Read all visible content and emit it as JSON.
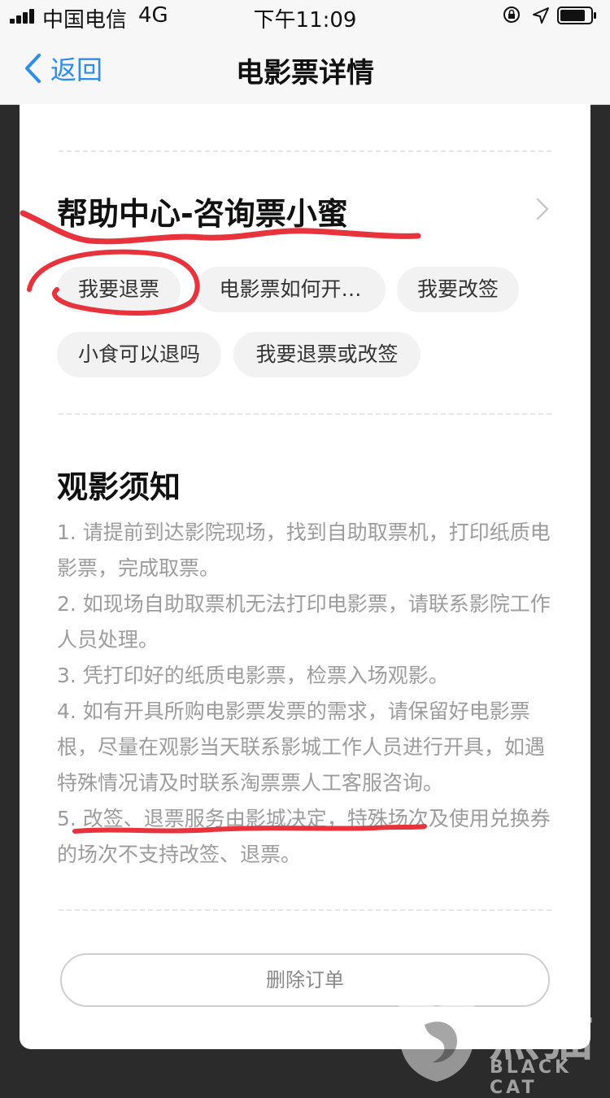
{
  "status_bar": {
    "carrier": "中国电信",
    "network": "4G",
    "time": "下午11:09"
  },
  "nav": {
    "back_label": "返回",
    "title": "电影票详情"
  },
  "help_center": {
    "title": "帮助中心-咨询票小蜜",
    "chips": [
      "我要退票",
      "电影票如何开…",
      "我要改签",
      "小食可以退吗",
      "我要退票或改签"
    ]
  },
  "notice": {
    "title": "观影须知",
    "items": [
      "1. 请提前到达影院现场，找到自助取票机，打印纸质电影票，完成取票。",
      "2. 如现场自助取票机无法打印电影票，请联系影院工作人员处理。",
      "3. 凭打印好的纸质电影票，检票入场观影。",
      "4. 如有开具所购电影票发票的需求，请保留好电影票根，尽量在观影当天联系影城工作人员进行开具，如遇特殊情况请及时联系淘票票人工客服咨询。",
      "5. 改签、退票服务由影城决定，特殊场次及使用兑换券的场次不支持改签、退票。"
    ]
  },
  "delete_order_label": "删除订单",
  "watermark": {
    "text": "黑猫",
    "sub": "BLACK CAT"
  },
  "colors": {
    "accent": "#2d8cf0",
    "annotation": "#e8323c",
    "muted_text": "#9c9c9c"
  }
}
